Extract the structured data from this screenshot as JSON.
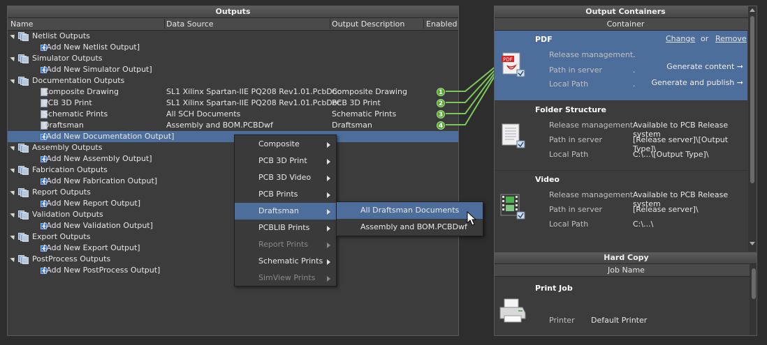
{
  "outputs_panel": {
    "title": "Outputs",
    "columns": [
      "Name",
      "Data Source",
      "Output Description",
      "Enabled"
    ],
    "rows": [
      {
        "type": "group",
        "label": "Netlist Outputs"
      },
      {
        "type": "add",
        "label": "[Add New Netlist Output]"
      },
      {
        "type": "group",
        "label": "Simulator Outputs"
      },
      {
        "type": "add",
        "label": "[Add New Simulator Output]"
      },
      {
        "type": "group",
        "label": "Documentation Outputs"
      },
      {
        "type": "item",
        "label": "Composite Drawing",
        "source": "SL1 Xilinx Spartan-IIE PQ208 Rev1.01.PcbDoc",
        "desc": "Composite Drawing",
        "badge": "1"
      },
      {
        "type": "item",
        "label": "PCB 3D Print",
        "source": "SL1 Xilinx Spartan-IIE PQ208 Rev1.01.PcbDoc",
        "desc": "PCB 3D Print",
        "badge": "2"
      },
      {
        "type": "item",
        "label": "Schematic Prints",
        "source": "All SCH Documents",
        "desc": "Schematic Prints",
        "badge": "3"
      },
      {
        "type": "item",
        "label": "Draftsman",
        "source": "Assembly and BOM.PCBDwf",
        "desc": "Draftsman",
        "badge": "4"
      },
      {
        "type": "add",
        "label": "[Add New Documentation Output]",
        "selected": true
      },
      {
        "type": "group",
        "label": "Assembly Outputs"
      },
      {
        "type": "add",
        "label": "[Add New Assembly Output]"
      },
      {
        "type": "group",
        "label": "Fabrication Outputs"
      },
      {
        "type": "add",
        "label": "[Add New Fabrication Output]"
      },
      {
        "type": "group",
        "label": "Report Outputs"
      },
      {
        "type": "add",
        "label": "[Add New Report Output]"
      },
      {
        "type": "group",
        "label": "Validation Outputs"
      },
      {
        "type": "add",
        "label": "[Add New Validation Output]"
      },
      {
        "type": "group",
        "label": "Export Outputs"
      },
      {
        "type": "add",
        "label": "[Add New Export Output]"
      },
      {
        "type": "group",
        "label": "PostProcess Outputs"
      },
      {
        "type": "add",
        "label": "[Add New PostProcess Output]"
      }
    ]
  },
  "context_menu": {
    "items": [
      {
        "label": "Composite",
        "enabled": true
      },
      {
        "label": "PCB 3D Print",
        "enabled": true
      },
      {
        "label": "PCB 3D Video",
        "enabled": true
      },
      {
        "label": "PCB Prints",
        "enabled": true
      },
      {
        "label": "Draftsman",
        "enabled": true,
        "highlighted": true
      },
      {
        "label": "PCBLIB Prints",
        "enabled": true
      },
      {
        "label": "Report Prints",
        "enabled": false
      },
      {
        "label": "Schematic Prints",
        "enabled": true
      },
      {
        "label": "SimView Prints",
        "enabled": false
      }
    ]
  },
  "submenu": {
    "items": [
      {
        "label": "All Draftsman Documents",
        "highlighted": true
      },
      {
        "label": "Assembly and BOM.PCBDwf",
        "highlighted": false
      }
    ]
  },
  "containers_panel": {
    "title": "Output Containers",
    "column": "Container",
    "cards": [
      {
        "title": "PDF",
        "icon": "pdf-icon",
        "change": "Change",
        "or": "or",
        "remove": "Remove",
        "labels": [
          "Release management",
          "Path in server",
          "Local Path"
        ],
        "values": [
          ".",
          ".",
          "."
        ],
        "actions": [
          "Generate content",
          "Generate and publish"
        ]
      },
      {
        "title": "Folder Structure",
        "icon": "folder-structure-icon",
        "labels": [
          "Release management",
          "Path in server",
          "Local Path"
        ],
        "values": [
          "Available to PCB Release system",
          "[Release server]\\[Output Type]\\",
          "C:\\...\\[Output Type]\\"
        ]
      },
      {
        "title": "Video",
        "icon": "video-icon",
        "labels": [
          "Release management",
          "Path in server",
          "Local Path"
        ],
        "values": [
          "Available to PCB Release system",
          "[Release server]\\",
          "C:\\...\\"
        ]
      }
    ],
    "hardcopy": {
      "title": "Hard Copy",
      "column": "Job Name",
      "job": "Print Job",
      "printer_label": "Printer",
      "printer_value": "Default Printer"
    }
  }
}
